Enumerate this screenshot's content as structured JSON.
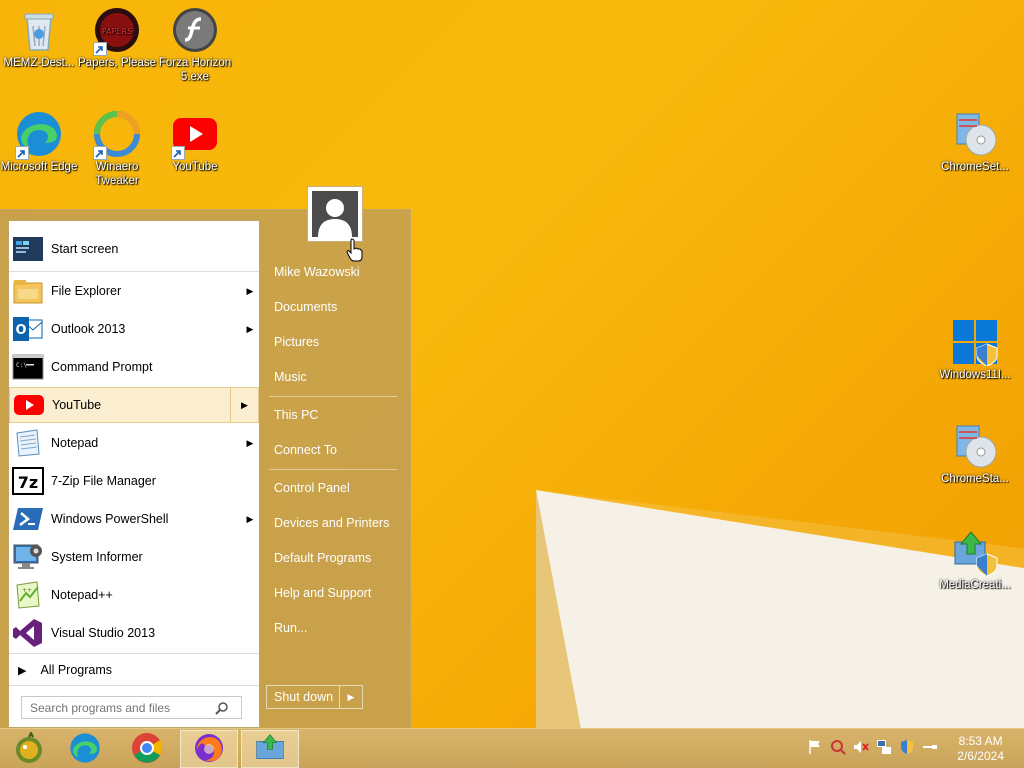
{
  "desktop": {
    "icons_top": [
      {
        "label": "MEMZ-Dest...",
        "icon": "recycle-bin-icon"
      },
      {
        "label": "Papers, Please",
        "icon": "papers-please-icon"
      },
      {
        "label": "Forza Horizon 5.exe",
        "icon": "flash-icon"
      }
    ],
    "icons_row2": [
      {
        "label": "Microsoft Edge",
        "icon": "edge-icon"
      },
      {
        "label": "Winaero Tweaker",
        "icon": "winaero-icon"
      },
      {
        "label": "YouTube",
        "icon": "youtube-icon"
      }
    ],
    "icons_right": [
      {
        "label": "ChromeSet...",
        "icon": "installer-cd-icon"
      },
      {
        "label": "Windows11I...",
        "icon": "windows-shield-icon"
      },
      {
        "label": "ChromeSta...",
        "icon": "installer-cd-icon"
      },
      {
        "label": "MediaCreati...",
        "icon": "media-creation-icon"
      }
    ]
  },
  "start_menu": {
    "left_items": [
      {
        "label": "Start screen",
        "has_submenu": false
      },
      {
        "label": "File Explorer",
        "has_submenu": true
      },
      {
        "label": "Outlook 2013",
        "has_submenu": true
      },
      {
        "label": "Command Prompt",
        "has_submenu": false
      },
      {
        "label": "YouTube",
        "has_submenu": true,
        "highlighted": true
      },
      {
        "label": "Notepad",
        "has_submenu": true
      },
      {
        "label": "7-Zip File Manager",
        "has_submenu": false
      },
      {
        "label": "Windows PowerShell",
        "has_submenu": true
      },
      {
        "label": "System Informer",
        "has_submenu": false
      },
      {
        "label": "Notepad++",
        "has_submenu": false
      },
      {
        "label": "Visual Studio 2013",
        "has_submenu": false
      }
    ],
    "all_programs": "All Programs",
    "search_placeholder": "Search programs and files",
    "right_items": [
      "Mike Wazowski",
      "Documents",
      "Pictures",
      "Music",
      "This PC",
      "Connect To",
      "Control Panel",
      "Devices and Printers",
      "Default Programs",
      "Help and Support",
      "Run..."
    ],
    "shutdown_label": "Shut down"
  },
  "taskbar": {
    "pinned": [
      "start-orb-icon",
      "edge-icon",
      "chrome-icon",
      "firefox-icon",
      "media-creation-icon"
    ],
    "clock_time": "8:53 AM",
    "clock_date": "2/6/2024"
  }
}
